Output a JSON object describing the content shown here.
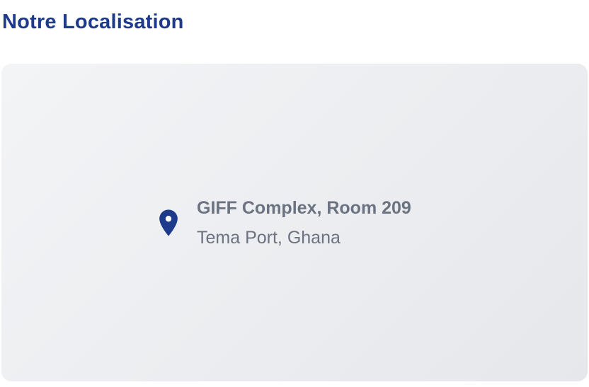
{
  "section": {
    "title": "Notre Localisation"
  },
  "location": {
    "icon": "map-pin-icon",
    "address_line1": "GIFF Complex, Room 209",
    "address_line2": "Tema Port, Ghana"
  },
  "colors": {
    "title": "#1e3a8a",
    "pin": "#1e3a8a",
    "address_text": "#6b7280",
    "card_gradient_start": "#f3f4f6",
    "card_gradient_end": "#e5e7eb"
  }
}
